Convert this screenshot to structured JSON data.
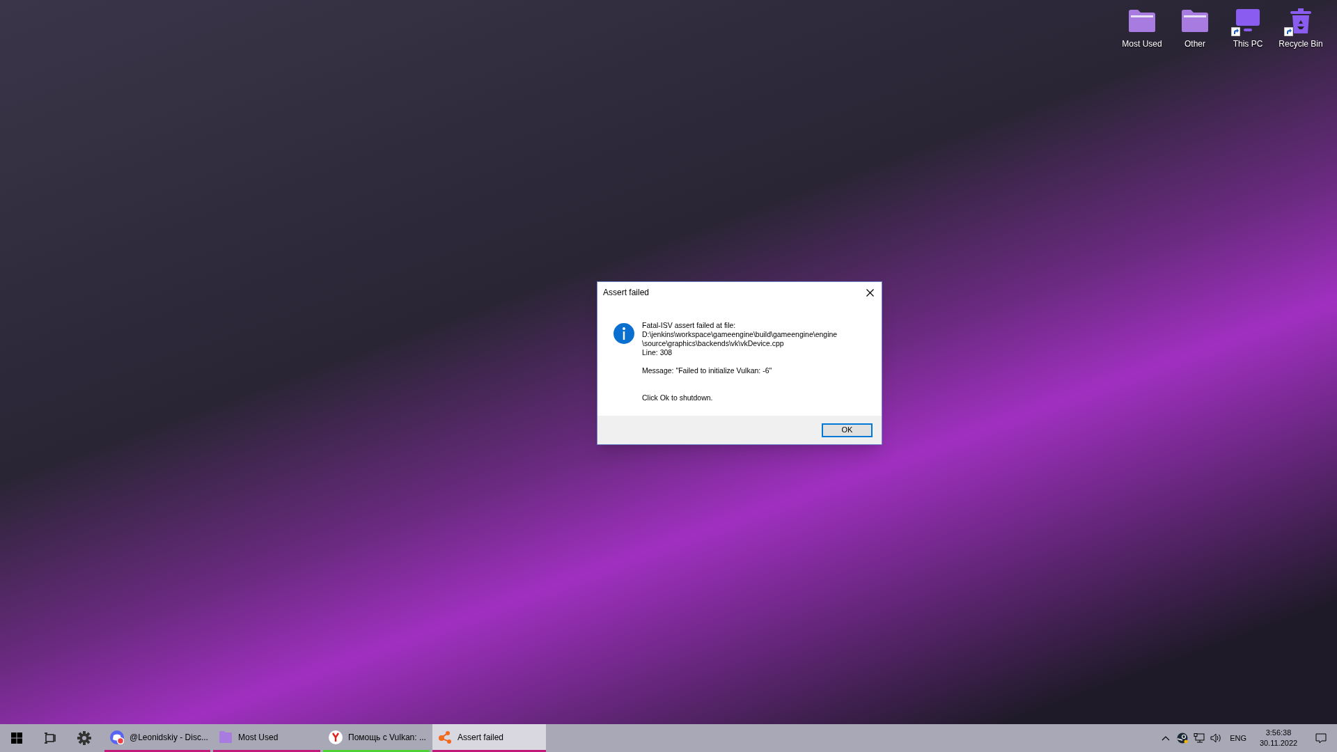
{
  "desktop_icons": [
    {
      "label": "Most Used",
      "kind": "folder",
      "shortcut": false
    },
    {
      "label": "Other",
      "kind": "folder",
      "shortcut": false
    },
    {
      "label": "This PC",
      "kind": "pc",
      "shortcut": true
    },
    {
      "label": "Recycle Bin",
      "kind": "bin",
      "shortcut": true
    }
  ],
  "dialog": {
    "title": "Assert failed",
    "lines": [
      "Fatal-ISV assert failed at file:",
      "D:\\jenkins\\workspace\\gameengine\\build\\gameengine\\engine",
      "\\source\\graphics\\backends\\vk\\vkDevice.cpp",
      "Line: 308"
    ],
    "message": "Message: \"Failed to initialize Vulkan: -6\"",
    "prompt": "Click Ok to shutdown.",
    "button": "OK"
  },
  "taskbar": {
    "apps": [
      {
        "label": "@Leonidskiy - Disc...",
        "kind": "chat",
        "selected": false,
        "color": "#c2187a"
      },
      {
        "label": "Most Used",
        "kind": "folder",
        "selected": false,
        "color": "#c2187a"
      },
      {
        "label": "Помощь с Vulkan: ...",
        "kind": "browser",
        "selected": false,
        "color": "#4cd137"
      },
      {
        "label": "Assert failed",
        "kind": "app",
        "selected": true,
        "color": "#c2187a"
      }
    ],
    "language": "ENG",
    "time": "3:56:38",
    "date": "30.11.2022"
  }
}
